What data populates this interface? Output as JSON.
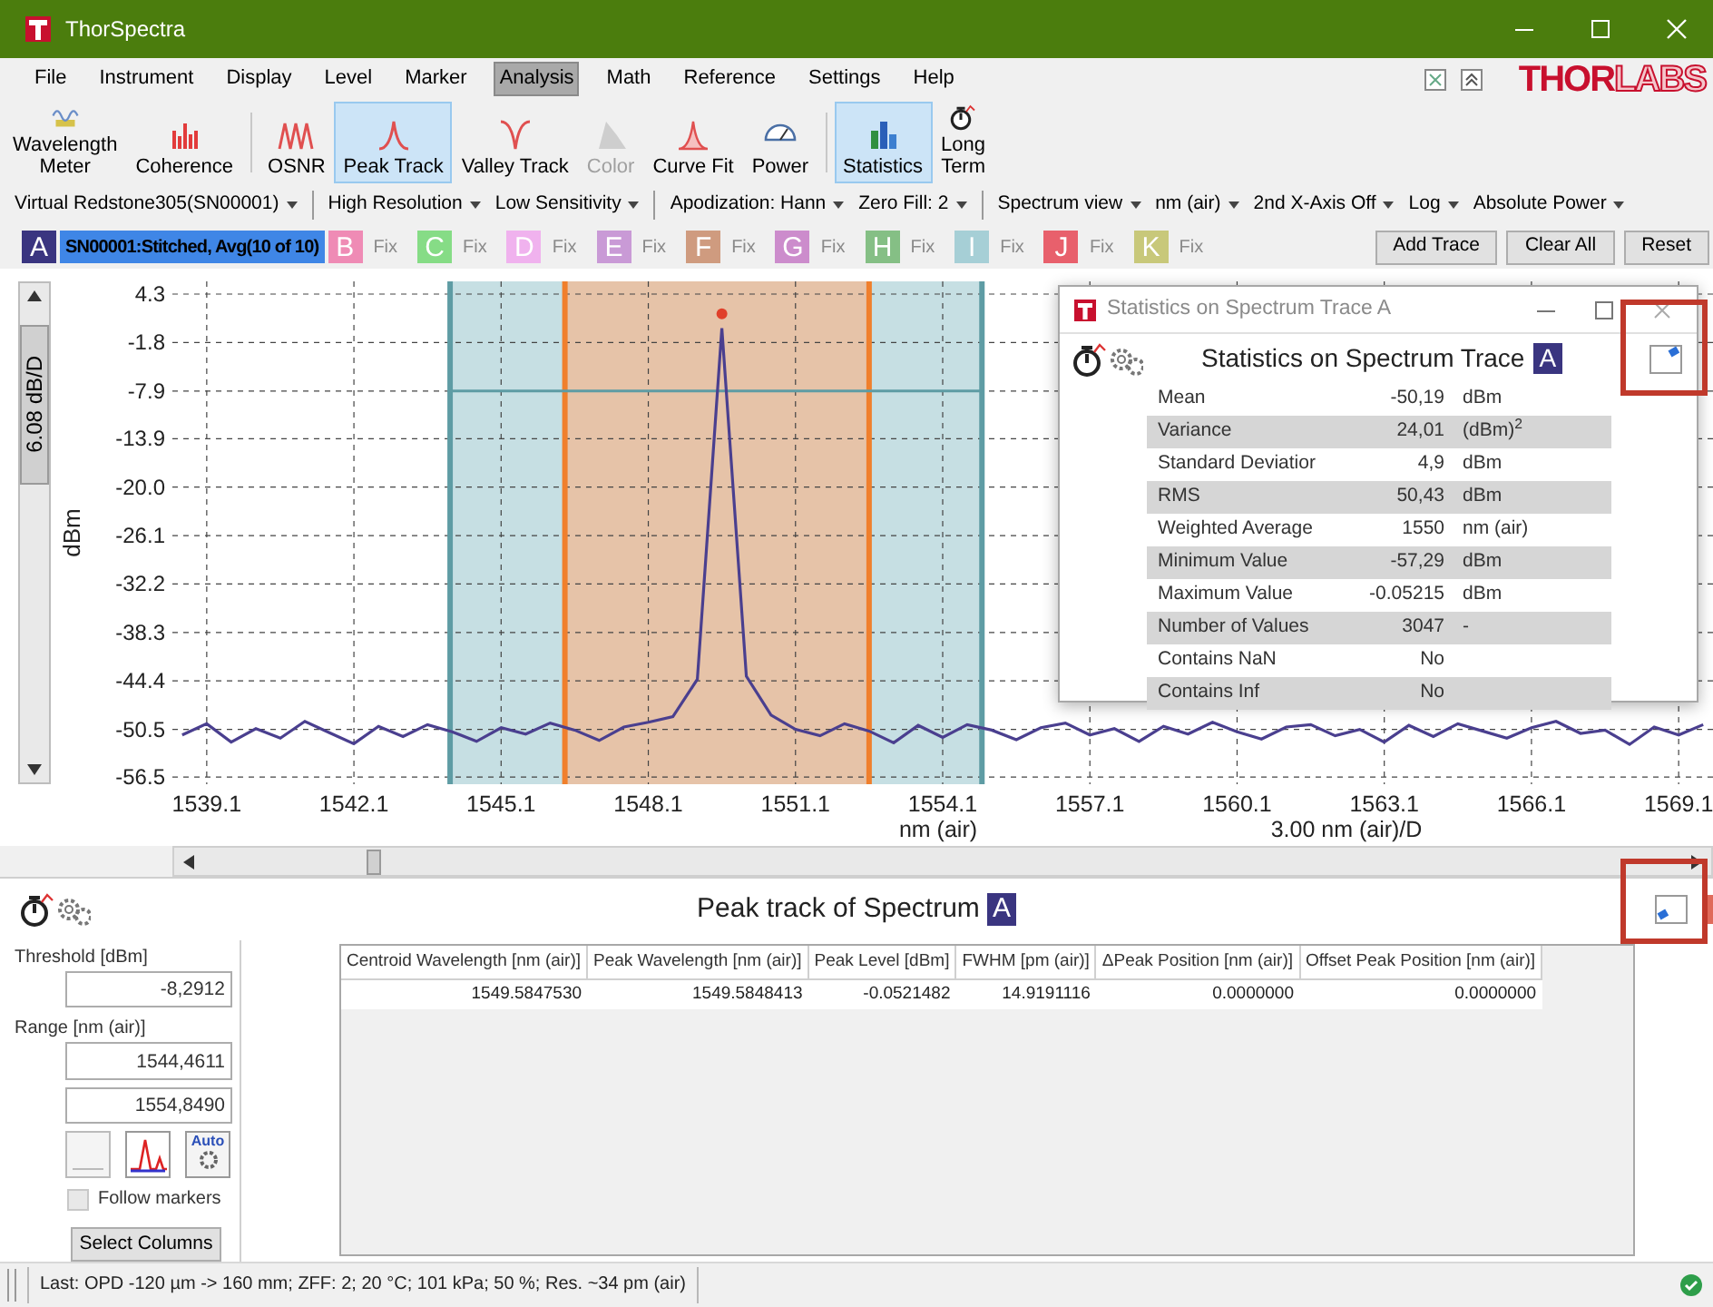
{
  "window": {
    "title": "ThorSpectra"
  },
  "menu": [
    {
      "label": "File",
      "selected": false
    },
    {
      "label": "Instrument",
      "selected": false
    },
    {
      "label": "Display",
      "selected": false
    },
    {
      "label": "Level",
      "selected": false
    },
    {
      "label": "Marker",
      "selected": false
    },
    {
      "label": "Analysis",
      "selected": true
    },
    {
      "label": "Math",
      "selected": false
    },
    {
      "label": "Reference",
      "selected": false
    },
    {
      "label": "Settings",
      "selected": false
    },
    {
      "label": "Help",
      "selected": false
    }
  ],
  "logo": {
    "solid": "THOR",
    "outline": "LABS"
  },
  "toolbar": [
    {
      "label": "Wavelength\nMeter",
      "selected": false,
      "disabled": false,
      "separator_before": false
    },
    {
      "label": "Coherence",
      "selected": false,
      "disabled": false,
      "separator_before": false
    },
    {
      "label": "OSNR",
      "selected": false,
      "disabled": false,
      "separator_before": true
    },
    {
      "label": "Peak Track",
      "selected": true,
      "disabled": false,
      "separator_before": false
    },
    {
      "label": "Valley Track",
      "selected": false,
      "disabled": false,
      "separator_before": false
    },
    {
      "label": "Color",
      "selected": false,
      "disabled": true,
      "separator_before": false
    },
    {
      "label": "Curve Fit",
      "selected": false,
      "disabled": false,
      "separator_before": false
    },
    {
      "label": "Power",
      "selected": false,
      "disabled": false,
      "separator_before": false
    },
    {
      "label": "Statistics",
      "selected": true,
      "disabled": false,
      "separator_before": true
    },
    {
      "label": "Long\nTerm",
      "selected": false,
      "disabled": false,
      "separator_before": false
    }
  ],
  "settings_bar": [
    [
      "Virtual Redstone305(SN00001)"
    ],
    [
      "High Resolution",
      "Low Sensitivity"
    ],
    [
      "Apodization: Hann",
      "Zero Fill: 2"
    ],
    [
      "Spectrum view",
      "nm (air)",
      "2nd X-Axis Off",
      "Log",
      "Absolute Power"
    ]
  ],
  "traces": [
    {
      "letter": "A",
      "label": "SN00001:Stitched, Avg(10 of 10)",
      "color": "#3a3580",
      "selected": true
    },
    {
      "letter": "B",
      "label": "Fix",
      "color": "#ef8bb5",
      "selected": false
    },
    {
      "letter": "C",
      "label": "Fix",
      "color": "#86dc86",
      "selected": false
    },
    {
      "letter": "D",
      "label": "Fix",
      "color": "#f0b2ee",
      "selected": false
    },
    {
      "letter": "E",
      "label": "Fix",
      "color": "#c99ad6",
      "selected": false
    },
    {
      "letter": "F",
      "label": "Fix",
      "color": "#cf9b7f",
      "selected": false
    },
    {
      "letter": "G",
      "label": "Fix",
      "color": "#cc8ccc",
      "selected": false
    },
    {
      "letter": "H",
      "label": "Fix",
      "color": "#85bf85",
      "selected": false
    },
    {
      "letter": "I",
      "label": "Fix",
      "color": "#a6cfd6",
      "selected": false
    },
    {
      "letter": "J",
      "label": "Fix",
      "color": "#e8606c",
      "selected": false
    },
    {
      "letter": "K",
      "label": "Fix",
      "color": "#c8c87a",
      "selected": false
    }
  ],
  "trace_buttons": [
    "Add Trace",
    "Clear All",
    "Reset"
  ],
  "spectrum": {
    "scale_label": "6.08 dB/D",
    "x_scale_label": "3.00 nm (air)/D",
    "chart_data": {
      "type": "line",
      "xlabel": "nm (air)",
      "ylabel": "dBm",
      "xlim": [
        1538.4,
        1569.8
      ],
      "ylim": [
        -57.4,
        5.9
      ],
      "xticks": [
        {
          "value": 1539.1,
          "label": "1539.1"
        },
        {
          "value": 1542.1,
          "label": "1542.1"
        },
        {
          "value": 1545.1,
          "label": "1545.1"
        },
        {
          "value": 1548.1,
          "label": "1548.1"
        },
        {
          "value": 1551.1,
          "label": "1551.1"
        },
        {
          "value": 1554.1,
          "label": "1554.1"
        },
        {
          "value": 1557.1,
          "label": "1557.1"
        },
        {
          "value": 1560.1,
          "label": "1560.1"
        },
        {
          "value": 1563.1,
          "label": "1563.1"
        },
        {
          "value": 1566.1,
          "label": "1566.1"
        },
        {
          "value": 1569.1,
          "label": "1569.1"
        }
      ],
      "yticks": [
        {
          "value": 4.3,
          "label": "4.3"
        },
        {
          "value": -1.8,
          "label": "-1.8"
        },
        {
          "value": -7.9,
          "label": "-7.9"
        },
        {
          "value": -13.9,
          "label": "-13.9"
        },
        {
          "value": -20,
          "label": "-20.0"
        },
        {
          "value": -26.1,
          "label": "-26.1"
        },
        {
          "value": -32.2,
          "label": "-32.2"
        },
        {
          "value": -38.3,
          "label": "-38.3"
        },
        {
          "value": -44.4,
          "label": "-44.4"
        },
        {
          "value": -50.5,
          "label": "-50.5"
        },
        {
          "value": -56.5,
          "label": "-56.5"
        }
      ],
      "x": [
        1538.6,
        1539.1,
        1539.6,
        1540.1,
        1540.6,
        1541.1,
        1541.6,
        1542.1,
        1542.6,
        1543.1,
        1543.6,
        1544.1,
        1544.6,
        1545.1,
        1545.6,
        1546.1,
        1546.6,
        1547.1,
        1547.6,
        1548.1,
        1548.6,
        1549.1,
        1549.6,
        1550.1,
        1550.6,
        1551.1,
        1551.6,
        1552.1,
        1552.6,
        1553.1,
        1553.6,
        1554.1,
        1554.6,
        1555.1,
        1555.6,
        1556.1,
        1556.6,
        1557.1,
        1557.6,
        1558.1,
        1558.6,
        1559.1,
        1559.6,
        1560.1,
        1560.6,
        1561.1,
        1561.6,
        1562.1,
        1562.6,
        1563.1,
        1563.6,
        1564.1,
        1564.6,
        1565.1,
        1565.6,
        1566.1,
        1566.6,
        1567.1,
        1567.6,
        1568.1,
        1568.6,
        1569.1,
        1569.6
      ],
      "grid": true,
      "series": [
        {
          "color": "#4a3f8f",
          "values": [
            -51.2,
            -49.8,
            -52.1,
            -50.4,
            -51.6,
            -49.5,
            -50.9,
            -52.3,
            -50.1,
            -51.4,
            -49.9,
            -50.8,
            -52.0,
            -50.3,
            -51.1,
            -49.7,
            -50.6,
            -51.9,
            -50.2,
            -49.6,
            -48.9,
            -44.2,
            0.0,
            -43.8,
            -48.7,
            -50.5,
            -51.3,
            -49.8,
            -50.7,
            -52.2,
            -50.0,
            -51.5,
            -49.9,
            -50.6,
            -51.8,
            -50.3,
            -49.7,
            -51.2,
            -50.4,
            -52.0,
            -50.1,
            -51.1,
            -49.6,
            -50.8,
            -51.7,
            -50.2,
            -49.9,
            -51.3,
            -50.5,
            -52.1,
            -50.0,
            -51.4,
            -49.8,
            -50.7,
            -51.6,
            -50.3,
            -49.5,
            -51.0,
            -50.6,
            -52.4,
            -50.2,
            -51.2,
            -49.9
          ]
        }
      ],
      "bands": [
        {
          "axis": "x",
          "from": 1544.06,
          "to": 1546.4,
          "color": "#c6dfe3"
        },
        {
          "axis": "x",
          "from": 1546.4,
          "to": 1552.6,
          "color": "#e6c3a8"
        },
        {
          "axis": "x",
          "from": 1552.6,
          "to": 1554.9,
          "color": "#c6dfe3"
        }
      ],
      "ref_lines": [
        {
          "axis": "x",
          "value": 1544.06,
          "color": "#5e9ca4"
        },
        {
          "axis": "x",
          "value": 1554.9,
          "color": "#5e9ca4"
        },
        {
          "axis": "x",
          "value": 1546.4,
          "color": "#f07f2c"
        },
        {
          "axis": "x",
          "value": 1552.6,
          "color": "#f07f2c"
        },
        {
          "axis": "y",
          "value": -7.9,
          "color": "#5e9ca4"
        }
      ]
    }
  },
  "statistics_window": {
    "title": "Statistics on Spectrum Trace A",
    "heading": "Statistics on Spectrum Trace",
    "trace_badge": "A",
    "rows": [
      {
        "label": "Mean",
        "value": "-50,19",
        "unit": "dBm"
      },
      {
        "label": "Variance",
        "value": "24,01",
        "unit": "(dBm)$^{2}$"
      },
      {
        "label": "Standard Deviatior",
        "value": "4,9",
        "unit": "dBm"
      },
      {
        "label": "RMS",
        "value": "50,43",
        "unit": "dBm"
      },
      {
        "label": "Weighted Average",
        "value": "1550",
        "unit": "nm (air)"
      },
      {
        "label": "Minimum Value",
        "value": "-57,29",
        "unit": "dBm"
      },
      {
        "label": "Maximum Value",
        "value": "-0.05215",
        "unit": "dBm"
      },
      {
        "label": "Number of Values",
        "value": "3047",
        "unit": "-"
      },
      {
        "label": "Contains NaN",
        "value": "No"
      },
      {
        "label": "Contains Inf",
        "value": "No"
      }
    ]
  },
  "peak_track": {
    "title": "Peak track of Spectrum",
    "trace_badge": "A",
    "threshold_label": "Threshold [dBm]",
    "threshold": "-8,2912",
    "range_label": "Range [nm (air)]",
    "range_start": "1544,4611",
    "range_end": "1554,8490",
    "auto_label": "Auto",
    "follow_markers": {
      "label": "Follow markers",
      "checked": false
    },
    "select_columns": "Select Columns",
    "table": {
      "columns": [
        "Centroid Wavelength [nm (air)]",
        "Peak Wavelength [nm (air)]",
        "Peak Level [dBm]",
        "FWHM [pm (air)]",
        "ΔPeak Position [nm (air)]",
        "Offset Peak Position [nm (air)]"
      ],
      "rows": [
        [
          "1549.5847530",
          "1549.5848413",
          "-0.0521482",
          "14.9191116",
          "0.0000000",
          "0.0000000"
        ]
      ]
    }
  },
  "status_bar": {
    "text": "Last: OPD -120 µm -> 160 mm; ZFF: 2; 20 °C; 101 kPa; 50 %; Res. ~34 pm (air)"
  }
}
